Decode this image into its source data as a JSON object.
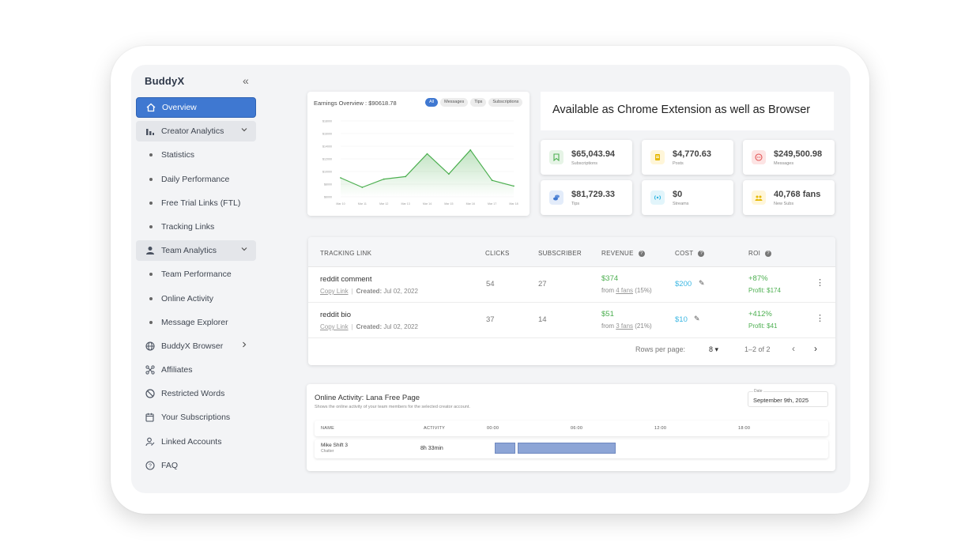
{
  "sidebar": {
    "brand": "BuddyX",
    "items": [
      {
        "label": "Overview",
        "type": "active",
        "icon": "home-icon"
      },
      {
        "label": "Creator Analytics",
        "type": "group",
        "icon": "bar-chart-icon"
      },
      {
        "label": "Statistics",
        "type": "sub"
      },
      {
        "label": "Daily Performance",
        "type": "sub"
      },
      {
        "label": "Free Trial Links (FTL)",
        "type": "sub"
      },
      {
        "label": "Tracking Links",
        "type": "sub"
      },
      {
        "label": "Team Analytics",
        "type": "group",
        "icon": "person-icon"
      },
      {
        "label": "Team Performance",
        "type": "sub"
      },
      {
        "label": "Online Activity",
        "type": "sub"
      },
      {
        "label": "Message Explorer",
        "type": "sub"
      },
      {
        "label": "BuddyX Browser",
        "type": "link-chev",
        "icon": "globe-icon"
      },
      {
        "label": "Affiliates",
        "type": "link",
        "icon": "network-icon"
      },
      {
        "label": "Restricted Words",
        "type": "link",
        "icon": "block-icon"
      },
      {
        "label": "Your Subscriptions",
        "type": "link",
        "icon": "calendar-icon"
      },
      {
        "label": "Linked Accounts",
        "type": "link",
        "icon": "user-link-icon"
      },
      {
        "label": "FAQ",
        "type": "link",
        "icon": "help-icon"
      }
    ]
  },
  "earnings": {
    "title": "Earnings Overview : $90618.78",
    "filters": [
      "All",
      "Messages",
      "Tips",
      "Subscriptions"
    ],
    "active_filter": "All"
  },
  "chart_data": {
    "type": "line",
    "title": "Earnings Overview : $90618.78",
    "categories": [
      "Mar 10",
      "Mar 11",
      "Mar 12",
      "Mar 13",
      "Mar 14",
      "Mar 15",
      "Mar 16",
      "Mar 17",
      "Mar 18"
    ],
    "values": [
      9000,
      7500,
      8800,
      9200,
      12800,
      9600,
      13400,
      8600,
      7700
    ],
    "yticks": [
      "$18000",
      "$16000",
      "$14000",
      "$12000",
      "$10000",
      "$8000",
      "$6000"
    ],
    "ylim": [
      6000,
      18000
    ],
    "color": "#4caf50"
  },
  "banner": {
    "text": "Available as Chrome Extension as well as Browser"
  },
  "stats": [
    {
      "value": "$65,043.94",
      "label": "Subscriptions",
      "icon": "bookmark-icon",
      "bg": "#e6f4e6",
      "fg": "#4caf50"
    },
    {
      "value": "$4,770.63",
      "label": "Posts",
      "icon": "post-icon",
      "bg": "#fff6d9",
      "fg": "#e6b800"
    },
    {
      "value": "$249,500.98",
      "label": "Messages",
      "icon": "chat-icon",
      "bg": "#fde4e4",
      "fg": "#e25555"
    },
    {
      "value": "$81,729.33",
      "label": "Tips",
      "icon": "coins-icon",
      "bg": "#e3ecfa",
      "fg": "#3f78d1"
    },
    {
      "value": "$0",
      "label": "Streams",
      "icon": "broadcast-icon",
      "bg": "#e2f5fb",
      "fg": "#2bb3e0"
    },
    {
      "value": "40,768 fans",
      "label": "New Subs",
      "icon": "fans-icon",
      "bg": "#fff6d9",
      "fg": "#e6b800"
    }
  ],
  "tracking_table": {
    "headers": [
      "TRACKING LINK",
      "CLICKS",
      "SUBSCRIBER",
      "REVENUE",
      "COST",
      "ROI"
    ],
    "rows": [
      {
        "name": "reddit comment",
        "copy": "Copy Link",
        "created_label": "Created:",
        "created": "Jul 02, 2022",
        "clicks": "54",
        "subs": "27",
        "revenue": "$374",
        "rev_from": "from",
        "rev_fans": "4 fans",
        "rev_pct": "(15%)",
        "cost": "$200",
        "roi": "+87%",
        "profit_label": "Profit:",
        "profit": "$174"
      },
      {
        "name": "reddit bio",
        "copy": "Copy Link",
        "created_label": "Created:",
        "created": "Jul 02, 2022",
        "clicks": "37",
        "subs": "14",
        "revenue": "$51",
        "rev_from": "from",
        "rev_fans": "3 fans",
        "rev_pct": "(21%)",
        "cost": "$10",
        "roi": "+412%",
        "profit_label": "Profit:",
        "profit": "$41"
      }
    ],
    "rows_per_page_label": "Rows per page:",
    "rows_per_page": "8",
    "range": "1–2 of 2"
  },
  "online_activity": {
    "title": "Online Activity: Lana Free Page",
    "subtitle": "Shows the online activity of your team members for the selected creator account.",
    "date_label": "Date",
    "date": "September 9th, 2025",
    "headers": [
      "NAME",
      "ACTIVITY",
      "00:00",
      "06:00",
      "12:00",
      "18:00"
    ],
    "rows": [
      {
        "name": "Mike Shift 3",
        "role": "Chatter",
        "activity": "8h 33min"
      }
    ]
  }
}
